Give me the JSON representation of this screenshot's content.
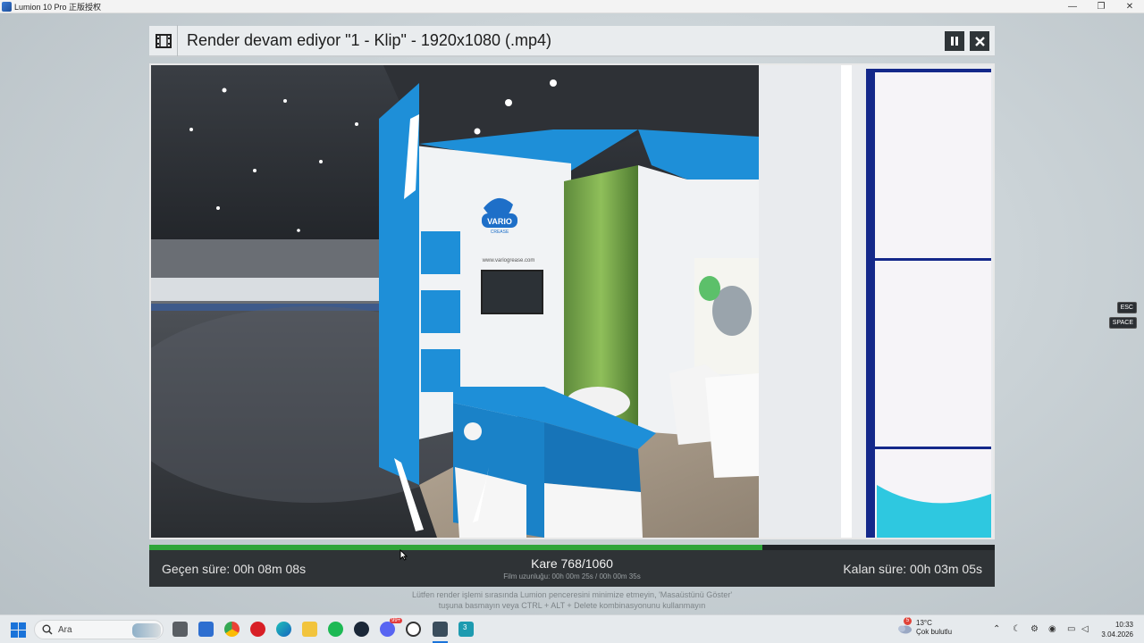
{
  "window": {
    "title": "Lumion 10 Pro 正版授权",
    "minimize": "—",
    "restore": "❐",
    "close": "✕"
  },
  "render": {
    "title": "Render devam ediyor \"1 - Klip\" - 1920x1080 (.mp4)",
    "progress_percent": 72.5,
    "elapsed": "Geçen süre: 00h 08m 08s",
    "frame": "Kare 768/1060",
    "film_length": "Film uzunluğu: 00h 00m 25s / 00h 00m 35s",
    "remaining": "Kalan süre: 00h 03m 05s",
    "notice_line1": "Lütfen render işlemi sırasında Lumion penceresini minimize etmeyin, 'Masaüstünü Göster'",
    "notice_line2": "tuşuna basmayın veya CTRL + ALT + Delete kombinasyonunu kullanmayın",
    "preview_brand": "VARIO",
    "preview_brand_sub": "CREASE",
    "preview_url": "www.variogrease.com"
  },
  "keys": {
    "esc": "ESC",
    "space": "SPACE"
  },
  "taskbar": {
    "search_placeholder": "Ara",
    "weather_badge": "5",
    "weather_temp": "13°C",
    "weather_desc": "Çok bulutlu",
    "time": "10:33",
    "date": "3.04.2026",
    "discord_badge": "99+",
    "taskview_badge": "3"
  },
  "colors": {
    "progress": "#2fa53a",
    "status_bar": "#2f3336",
    "stand_blue": "#1e8fd8"
  }
}
